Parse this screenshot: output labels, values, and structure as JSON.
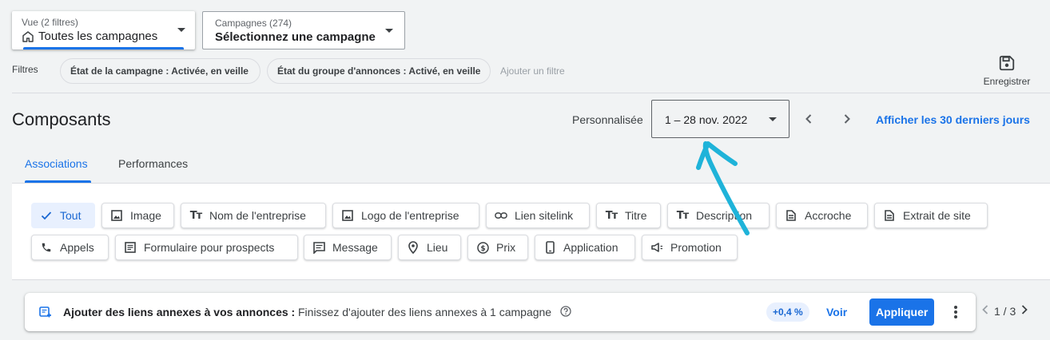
{
  "view_picker": {
    "label": "Vue (2 filtres)",
    "value": "Toutes les campagnes"
  },
  "campaign_picker": {
    "label": "Campagnes (274)",
    "value": "Sélectionnez une campagne"
  },
  "filters": {
    "label": "Filtres",
    "chips": [
      "État de la campagne : Activée, en veille",
      "État du groupe d'annonces : Activé, en veille"
    ],
    "add": "Ajouter un filtre"
  },
  "save": {
    "label": "Enregistrer"
  },
  "page": {
    "title": "Composants"
  },
  "date": {
    "preset": "Personnalisée",
    "range": "1 – 28 nov. 2022",
    "last30": "Afficher les 30 derniers jours"
  },
  "tabs": [
    {
      "label": "Associations",
      "active": true
    },
    {
      "label": "Performances",
      "active": false
    }
  ],
  "asset_types": [
    {
      "label": "Tout",
      "icon": "check-icon",
      "selected": true
    },
    {
      "label": "Image",
      "icon": "image-icon"
    },
    {
      "label": "Nom de l'entreprise",
      "icon": "text-size-icon"
    },
    {
      "label": "Logo de l'entreprise",
      "icon": "image-icon"
    },
    {
      "label": "Lien sitelink",
      "icon": "link-icon"
    },
    {
      "label": "Titre",
      "icon": "text-size-icon"
    },
    {
      "label": "Description",
      "icon": "text-size-icon"
    },
    {
      "label": "Accroche",
      "icon": "article-icon"
    },
    {
      "label": "Extrait de site",
      "icon": "article-icon"
    },
    {
      "label": "Appels",
      "icon": "phone-icon"
    },
    {
      "label": "Formulaire pour prospects",
      "icon": "form-icon"
    },
    {
      "label": "Message",
      "icon": "message-icon"
    },
    {
      "label": "Lieu",
      "icon": "location-pin-icon"
    },
    {
      "label": "Prix",
      "icon": "price-icon"
    },
    {
      "label": "Application",
      "icon": "smartphone-icon"
    },
    {
      "label": "Promotion",
      "icon": "megaphone-icon"
    }
  ],
  "recommendation": {
    "title": "Ajouter des liens annexes à vos annonces :",
    "description": "Finissez d'ajouter des liens annexes à 1 campagne",
    "badge": "+0,4 %",
    "view": "Voir",
    "apply": "Appliquer",
    "pager": "1 / 3"
  },
  "colors": {
    "accent": "#1a73e8",
    "annotation_arrow": "#1fb3d9"
  }
}
